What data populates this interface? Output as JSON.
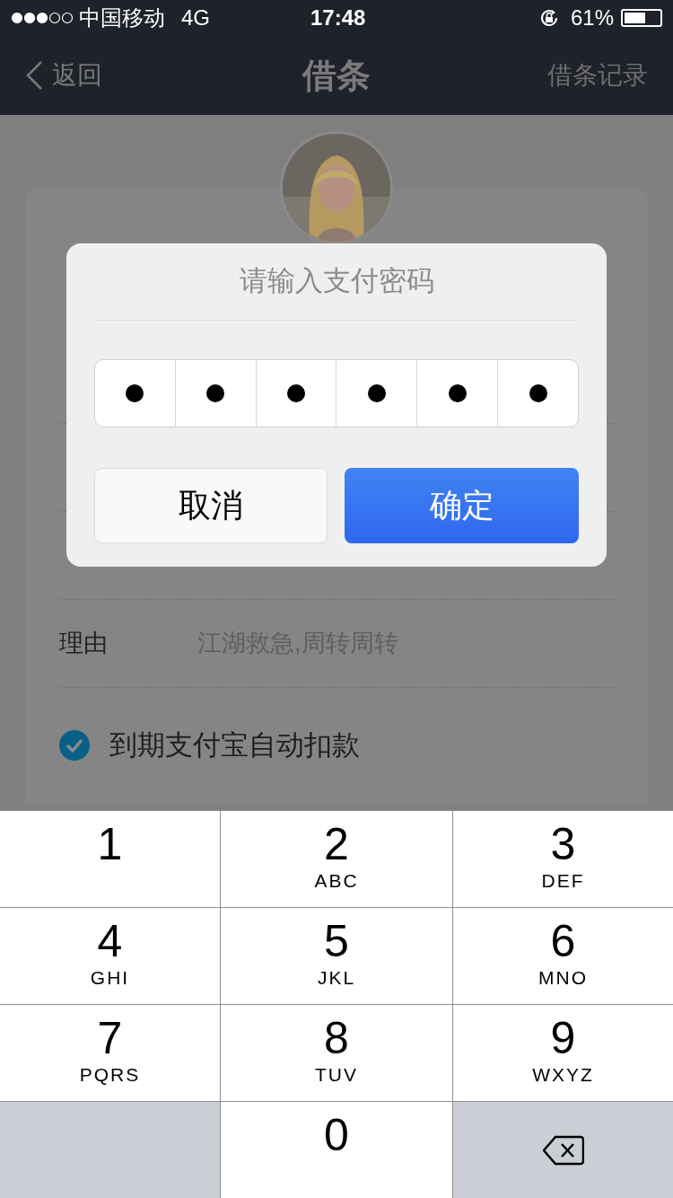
{
  "status_bar": {
    "carrier": "中国移动",
    "network": "4G",
    "time": "17:48",
    "battery": "61%"
  },
  "nav": {
    "back": "返回",
    "title": "借条",
    "action": "借条记录"
  },
  "form": {
    "rows": [
      {
        "kind": "hidden"
      },
      {
        "kind": "hidden"
      },
      {
        "kind": "hidden"
      },
      {
        "kind": "text",
        "label": "理由",
        "placeholder": "江湖救急,周转周转"
      }
    ],
    "autopay": {
      "label": "到期支付宝自动扣款",
      "checked": true
    }
  },
  "dialog": {
    "title": "请输入支付密码",
    "pin_cells": [
      {
        "filled": true
      },
      {
        "filled": true
      },
      {
        "filled": true
      },
      {
        "filled": true
      },
      {
        "filled": true
      },
      {
        "filled": true
      }
    ],
    "buttons": [
      {
        "kind": "cancel",
        "label": "取消"
      },
      {
        "kind": "confirm",
        "label": "确定"
      }
    ]
  },
  "keypad": [
    {
      "kind": "digit",
      "digit": "1"
    },
    {
      "kind": "digit",
      "digit": "2",
      "letters": "ABC"
    },
    {
      "kind": "digit",
      "digit": "3",
      "letters": "DEF"
    },
    {
      "kind": "digit",
      "digit": "4",
      "letters": "GHI"
    },
    {
      "kind": "digit",
      "digit": "5",
      "letters": "JKL"
    },
    {
      "kind": "digit",
      "digit": "6",
      "letters": "MNO"
    },
    {
      "kind": "digit",
      "digit": "7",
      "letters": "PQRS"
    },
    {
      "kind": "digit",
      "digit": "8",
      "letters": "TUV"
    },
    {
      "kind": "digit",
      "digit": "9",
      "letters": "WXYZ"
    },
    {
      "kind": "blank"
    },
    {
      "kind": "digit",
      "digit": "0"
    },
    {
      "kind": "delete"
    }
  ]
}
